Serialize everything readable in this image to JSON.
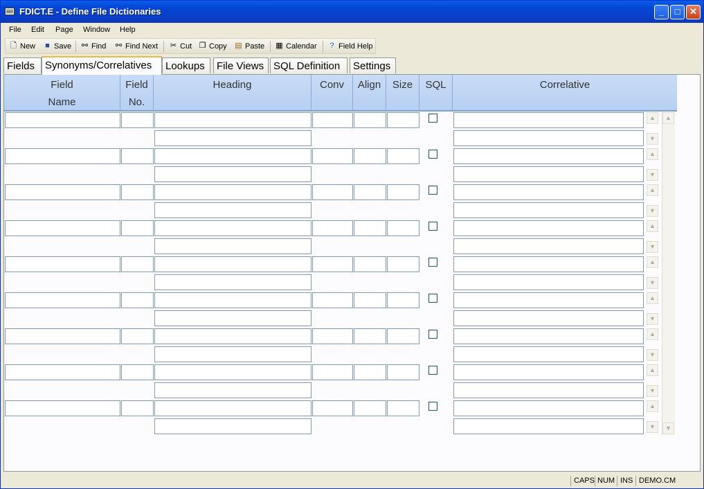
{
  "window": {
    "title": "FDICT.E - Define File Dictionaries"
  },
  "menu": [
    "File",
    "Edit",
    "Page",
    "Window",
    "Help"
  ],
  "toolbar": {
    "new": "New",
    "save": "Save",
    "find": "Find",
    "find_next": "Find Next",
    "cut": "Cut",
    "copy": "Copy",
    "paste": "Paste",
    "calendar": "Calendar",
    "field_help": "Field Help"
  },
  "tabs": [
    "Fields",
    "Synonyms/Correlatives",
    "Lookups",
    "File Views",
    "SQL Definition",
    "Settings"
  ],
  "active_tab": "Synonyms/Correlatives",
  "columns": {
    "field_name": [
      "Field",
      "Name"
    ],
    "field_no": [
      "Field",
      "No."
    ],
    "heading": "Heading",
    "conv": "Conv",
    "align": "Align",
    "size": "Size",
    "sql": "SQL",
    "correlative": "Correlative"
  },
  "rows": [
    {
      "field_name": "",
      "field_no": "",
      "heading1": "",
      "heading2": "",
      "conv": "",
      "align": "",
      "size": "",
      "sql": false,
      "correlative1": "",
      "correlative2": ""
    },
    {
      "field_name": "",
      "field_no": "",
      "heading1": "",
      "heading2": "",
      "conv": "",
      "align": "",
      "size": "",
      "sql": false,
      "correlative1": "",
      "correlative2": ""
    },
    {
      "field_name": "",
      "field_no": "",
      "heading1": "",
      "heading2": "",
      "conv": "",
      "align": "",
      "size": "",
      "sql": false,
      "correlative1": "",
      "correlative2": ""
    },
    {
      "field_name": "",
      "field_no": "",
      "heading1": "",
      "heading2": "",
      "conv": "",
      "align": "",
      "size": "",
      "sql": false,
      "correlative1": "",
      "correlative2": ""
    },
    {
      "field_name": "",
      "field_no": "",
      "heading1": "",
      "heading2": "",
      "conv": "",
      "align": "",
      "size": "",
      "sql": false,
      "correlative1": "",
      "correlative2": ""
    },
    {
      "field_name": "",
      "field_no": "",
      "heading1": "",
      "heading2": "",
      "conv": "",
      "align": "",
      "size": "",
      "sql": false,
      "correlative1": "",
      "correlative2": ""
    },
    {
      "field_name": "",
      "field_no": "",
      "heading1": "",
      "heading2": "",
      "conv": "",
      "align": "",
      "size": "",
      "sql": false,
      "correlative1": "",
      "correlative2": ""
    },
    {
      "field_name": "",
      "field_no": "",
      "heading1": "",
      "heading2": "",
      "conv": "",
      "align": "",
      "size": "",
      "sql": false,
      "correlative1": "",
      "correlative2": ""
    },
    {
      "field_name": "",
      "field_no": "",
      "heading1": "",
      "heading2": "",
      "conv": "",
      "align": "",
      "size": "",
      "sql": false,
      "correlative1": "",
      "correlative2": ""
    }
  ],
  "status": {
    "caps": "CAPS",
    "num": "NUM",
    "ins": "INS",
    "account": "DEMO.CM"
  },
  "icons": {
    "new": "new-document-icon",
    "save": "floppy-disk-icon",
    "find": "binoculars-icon",
    "find_next": "binoculars-next-icon",
    "cut": "scissors-icon",
    "copy": "copy-icon",
    "paste": "clipboard-icon",
    "calendar": "calendar-icon",
    "field_help": "help-icon",
    "scroll_up": "scroll-up-icon",
    "scroll_down": "scroll-down-icon"
  },
  "colors": {
    "title_bar": "#0a46d6",
    "header_bg": "#c2d7f4",
    "active_tab_accent": "#f1b742",
    "input_border": "#7f9db9"
  }
}
